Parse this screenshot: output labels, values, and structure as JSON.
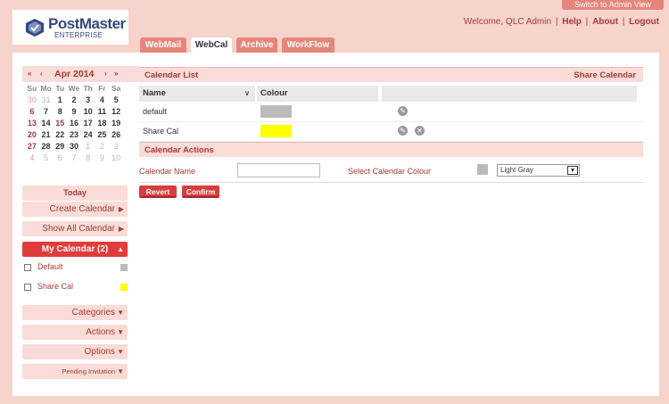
{
  "header": {
    "admin_view_label": "Switch to Admin View",
    "logo_name": "PostMaster",
    "logo_sub": "ENTERPRISE",
    "welcome": "Welcome, QLC Admin",
    "links": [
      "Help",
      "About",
      "Logout"
    ]
  },
  "tabs": [
    {
      "label": "WebMail",
      "active": false
    },
    {
      "label": "WebCal",
      "active": true
    },
    {
      "label": "Archive",
      "active": false
    },
    {
      "label": "WorkFlow",
      "active": false
    }
  ],
  "mini_calendar": {
    "month_label": "Apr 2014",
    "prev_year": "«",
    "prev_month": "‹",
    "next_month": "›",
    "next_year": "»",
    "weekdays": [
      "Su",
      "Mo",
      "Tu",
      "We",
      "Th",
      "Fr",
      "Sa"
    ],
    "weeks": [
      [
        "30",
        "31",
        "1",
        "2",
        "3",
        "4",
        "5"
      ],
      [
        "6",
        "7",
        "8",
        "9",
        "10",
        "11",
        "12"
      ],
      [
        "13",
        "14",
        "15",
        "16",
        "17",
        "18",
        "19"
      ],
      [
        "20",
        "21",
        "22",
        "23",
        "24",
        "25",
        "26"
      ],
      [
        "27",
        "28",
        "29",
        "30",
        "1",
        "2",
        "3"
      ],
      [
        "4",
        "5",
        "6",
        "7",
        "8",
        "9",
        "10"
      ]
    ],
    "today_label": "Today"
  },
  "sidebar": {
    "create_calendar": "Create Calendar",
    "show_all_calendar": "Show All Calendar",
    "my_calendar": "My Calendar",
    "my_calendar_count": "(2)",
    "calendars": [
      {
        "label": "Default",
        "color": "#bbbbbb"
      },
      {
        "label": "Share Cal",
        "color": "#ffff00"
      }
    ],
    "categories": "Categories",
    "actions": "Actions",
    "options": "Options",
    "pending_invitation": "Pending Invitation"
  },
  "calendar_list": {
    "title": "Calendar List",
    "share_label": "Share Calendar",
    "col_name": "Name",
    "col_colour": "Colour",
    "rows": [
      {
        "name": "default",
        "color": "#bbbbbb",
        "deletable": false
      },
      {
        "name": "Share Cal",
        "color": "#ffff00",
        "deletable": true
      }
    ]
  },
  "calendar_actions": {
    "title": "Calendar Actions",
    "name_label": "Calendar Name",
    "name_value": "",
    "colour_label": "Select Calendar Colour",
    "colour_value": "Light Gray",
    "revert_label": "Revert",
    "confirm_label": "Confirm"
  },
  "colors": {
    "accent": "#a73a3a",
    "tab": "#e6857a",
    "active_button": "#e23b3b",
    "page_bg": "#f7d4cb"
  }
}
